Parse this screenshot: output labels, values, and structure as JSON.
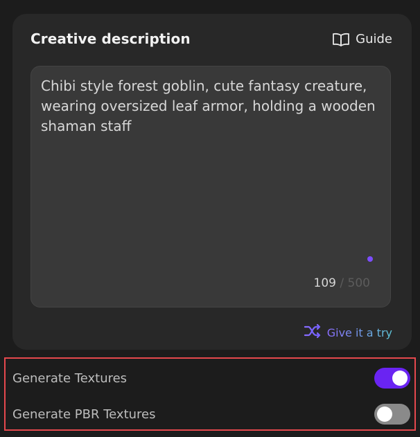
{
  "card": {
    "title": "Creative description",
    "guide_label": "Guide",
    "guide_icon": "book-icon"
  },
  "prompt": {
    "text": "Chibi style forest goblin, cute fantasy creature, wearing oversized leaf armor, holding a wooden shaman staff",
    "char_count": "109",
    "separator": "/",
    "char_limit": "500"
  },
  "try_button": {
    "label": "Give it a try",
    "icon": "shuffle-icon"
  },
  "settings": {
    "generate_textures": {
      "label": "Generate Textures",
      "enabled": true
    },
    "generate_pbr_textures": {
      "label": "Generate PBR Textures",
      "enabled": false
    }
  },
  "colors": {
    "accent": "#6a24f2",
    "highlight_border": "#e5484d",
    "background": "#1c1c1c",
    "card": "#282828"
  }
}
